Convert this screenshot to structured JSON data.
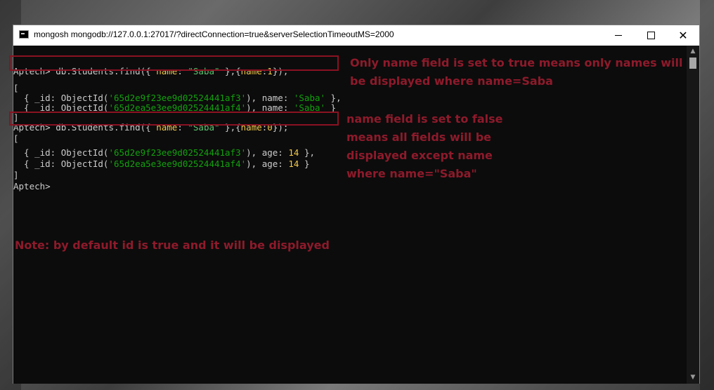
{
  "window": {
    "title": "mongosh mongodb://127.0.0.1:27017/?directConnection=true&serverSelectionTimeoutMS=2000"
  },
  "console": {
    "prompt": "Aptech>",
    "cmd1": {
      "pre": " db.Students.find({ ",
      "k1": "name",
      "m1": ": ",
      "v1": "\"Saba\"",
      "m2": " },{",
      "k2": "name",
      "m3": ":",
      "v2": "1",
      "post": "});"
    },
    "open1": "[",
    "r1": {
      "a": "  { _id: ObjectId(",
      "id": "'65d2e9f23ee9d02524441af3'",
      "b": "), name: ",
      "v": "'Saba'",
      "c": " },"
    },
    "r2": {
      "a": "  { _id: ObjectId(",
      "id": "'65d2ea5e3ee9d02524441af4'",
      "b": "), name: ",
      "v": "'Saba'",
      "c": " }"
    },
    "close1": "]",
    "cmd2": {
      "pre": " db.Students.find({ ",
      "k1": "name",
      "m1": ": ",
      "v1": "\"Saba\"",
      "m2": " },{",
      "k2": "name",
      "m3": ":",
      "v2": "0",
      "post": "});"
    },
    "open2": "[",
    "r3": {
      "a": "  { _id: ObjectId(",
      "id": "'65d2e9f23ee9d02524441af3'",
      "b": "), age: ",
      "v": "14",
      "c": " },"
    },
    "r4": {
      "a": "  { _id: ObjectId(",
      "id": "'65d2ea5e3ee9d02524441af4'",
      "b": "), age: ",
      "v": "14",
      "c": " }"
    },
    "close2": "]"
  },
  "annotations": {
    "a1_l1": "Only name field is set to true means only names will",
    "a1_l2": "be displayed where name=Saba",
    "a2_l1": "name field is set to false",
    "a2_l2": "means all fields will be",
    "a2_l3": "displayed except name",
    "a2_l4": "where name=\"Saba\"",
    "note": "Note: by default id is true and it will be displayed"
  },
  "colors": {
    "annotation": "#8e1a2b",
    "string": "#13a10e",
    "key": "#f2c94c",
    "background": "#0c0c0c"
  }
}
